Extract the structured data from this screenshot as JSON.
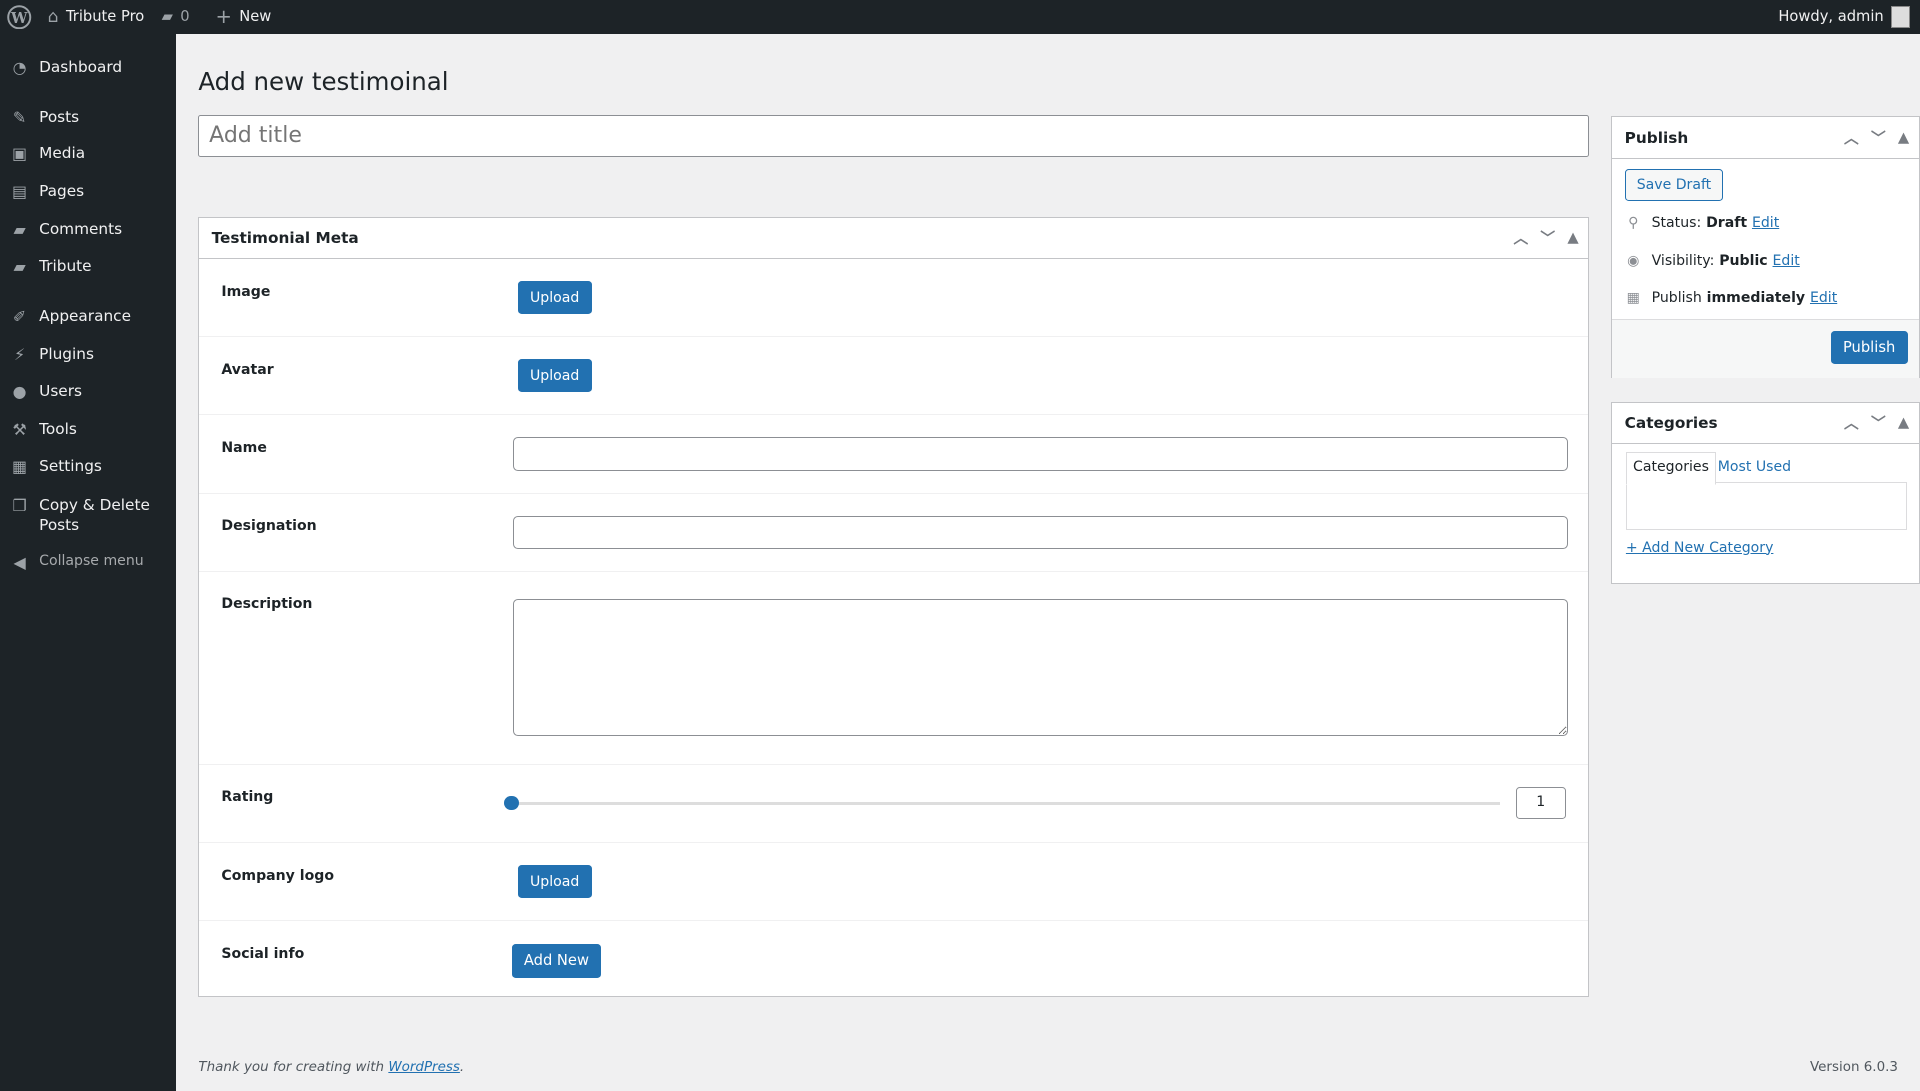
{
  "admin_bar": {
    "site_name": "Tribute Pro",
    "comments_count": "0",
    "new_label": "New",
    "greeting": "Howdy, admin"
  },
  "sidebar": {
    "items": [
      {
        "label": "Dashboard",
        "icon": "dashboard-icon"
      },
      {
        "label": "Posts",
        "icon": "pin-icon"
      },
      {
        "label": "Media",
        "icon": "media-icon"
      },
      {
        "label": "Pages",
        "icon": "pages-icon"
      },
      {
        "label": "Comments",
        "icon": "comments-icon"
      },
      {
        "label": "Tribute",
        "icon": "tribute-icon"
      },
      {
        "label": "Appearance",
        "icon": "brush-icon"
      },
      {
        "label": "Plugins",
        "icon": "plugin-icon"
      },
      {
        "label": "Users",
        "icon": "user-icon"
      },
      {
        "label": "Tools",
        "icon": "wrench-icon"
      },
      {
        "label": "Settings",
        "icon": "settings-icon"
      },
      {
        "label": "Copy & Delete Posts",
        "icon": "copy-icon"
      }
    ],
    "collapse_label": "Collapse menu"
  },
  "page": {
    "heading": "Add new testimoinal",
    "title_placeholder": "Add title"
  },
  "meta_box": {
    "title": "Testimonial Meta",
    "fields": {
      "image": {
        "label": "Image",
        "button": "Upload"
      },
      "avatar": {
        "label": "Avatar",
        "button": "Upload"
      },
      "name": {
        "label": "Name",
        "value": ""
      },
      "designation": {
        "label": "Designation",
        "value": ""
      },
      "description": {
        "label": "Description",
        "value": ""
      },
      "rating": {
        "label": "Rating",
        "value": "1"
      },
      "company_logo": {
        "label": "Company logo",
        "button": "Upload"
      },
      "social_info": {
        "label": "Social info",
        "button": "Add New"
      }
    }
  },
  "publish": {
    "title": "Publish",
    "save_draft": "Save Draft",
    "status_label": "Status:",
    "status_value": "Draft",
    "visibility_label": "Visibility:",
    "visibility_value": "Public",
    "schedule_label": "Publish",
    "schedule_value": "immediately",
    "edit": "Edit",
    "publish_button": "Publish"
  },
  "categories": {
    "title": "Categories",
    "tab_all": "Categories",
    "tab_most_used": "Most Used",
    "add_new": "+ Add New Category"
  },
  "footer": {
    "thanks": "Thank you for creating with",
    "wp_link": "WordPress",
    "version": "Version 6.0.3"
  },
  "colors": {
    "accent": "#2271b1",
    "admin_bar": "#1d2327",
    "background": "#f0f0f1"
  }
}
